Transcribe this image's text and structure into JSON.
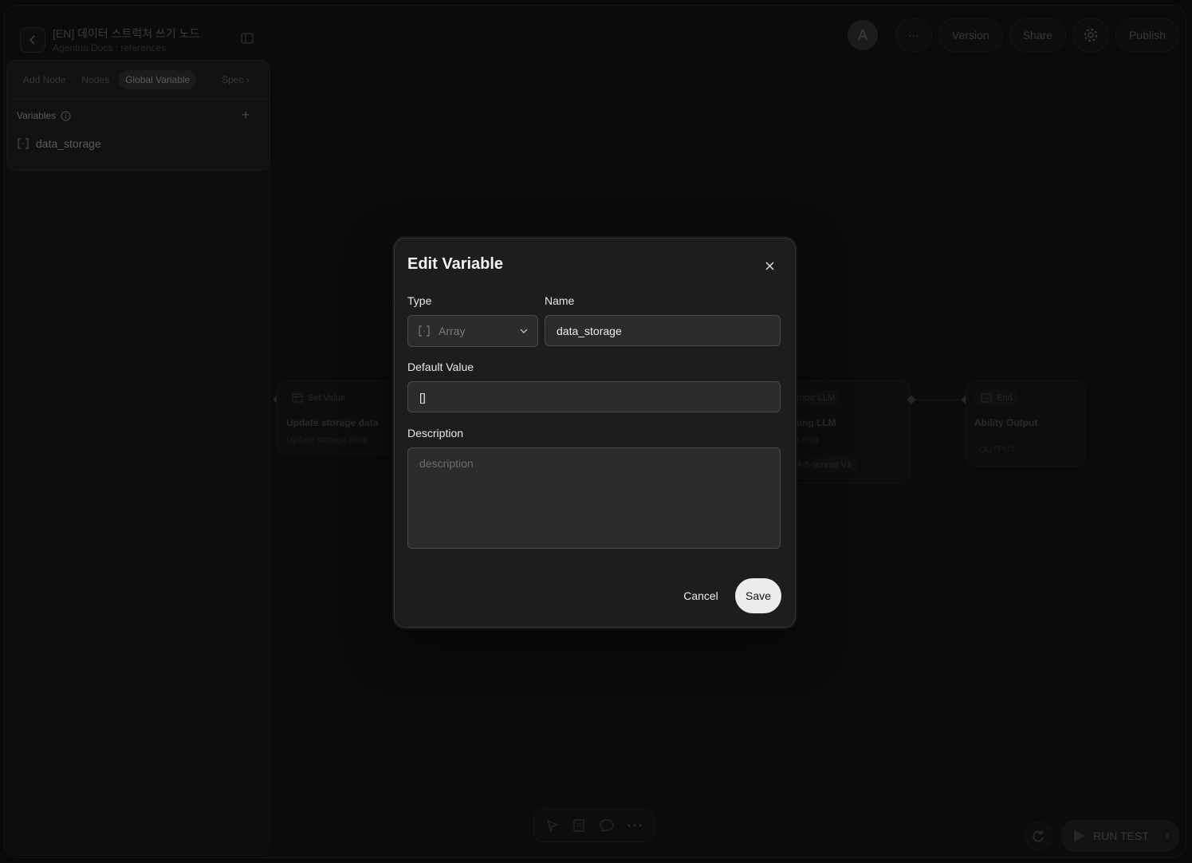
{
  "header": {
    "title": "[EN] 데이터 스트럭처 쓰기 노드",
    "subtitle": "Agentria Docs : references",
    "avatar_letter": "A",
    "more_label": "···",
    "version_label": "Version",
    "share_label": "Share",
    "publish_label": "Publish"
  },
  "sidebar": {
    "tabs": [
      {
        "label": "Add Node"
      },
      {
        "label": "Nodes"
      },
      {
        "label": "Global Variable"
      },
      {
        "label": "Spec"
      }
    ],
    "variables_label": "Variables",
    "items": [
      {
        "label": "data_storage",
        "icon": "array-icon"
      }
    ]
  },
  "canvas": {
    "nodes": [
      {
        "tag": "Set Value",
        "title": "Update storage data",
        "sub": "Update storage data"
      },
      {
        "tag": "ropic LLM",
        "title": "sing LLM",
        "sub": "g data",
        "model": "4-5-sonnet V1"
      },
      {
        "tag": "End",
        "title": "Ability Output",
        "sub": "OUTPUT"
      }
    ]
  },
  "bottom": {
    "run_label": "RUN TEST",
    "run_shortcut": "r"
  },
  "dialog": {
    "title": "Edit Variable",
    "type_label": "Type",
    "type_value": "Array",
    "name_label": "Name",
    "name_value": "data_storage",
    "default_label": "Default Value",
    "default_value": "[]",
    "description_label": "Description",
    "description_placeholder": "description",
    "cancel_label": "Cancel",
    "save_label": "Save"
  }
}
